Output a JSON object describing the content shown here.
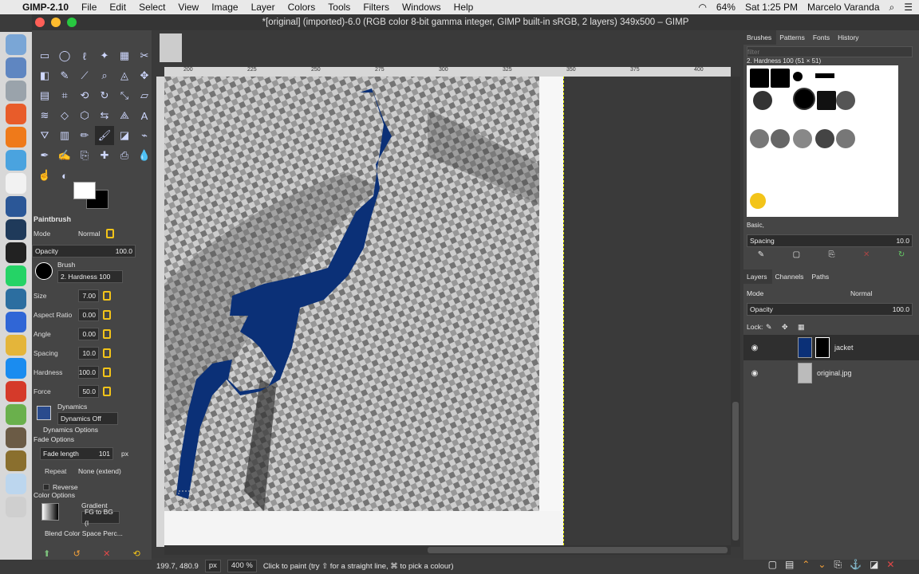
{
  "menubar": {
    "app_name": "GIMP-2.10",
    "menus": [
      "File",
      "Edit",
      "Select",
      "View",
      "Image",
      "Layer",
      "Colors",
      "Tools",
      "Filters",
      "Windows",
      "Help"
    ],
    "battery": "64%",
    "clock": "Sat 1:25 PM",
    "user": "Marcelo Varanda"
  },
  "window": {
    "title": "*[original] (imported)-6.0 (RGB color 8-bit gamma integer, GIMP built-in sRGB, 2 layers) 349x500 – GIMP"
  },
  "toolbox": {
    "tool_name": "Paintbrush",
    "mode_label": "Mode",
    "mode_value": "Normal",
    "opacity_label": "Opacity",
    "opacity_value": "100.0",
    "brush_label": "Brush",
    "brush_value": "2. Hardness 100",
    "size_label": "Size",
    "size_value": "7.00",
    "aspect_label": "Aspect Ratio",
    "aspect_value": "0.00",
    "angle_label": "Angle",
    "angle_value": "0.00",
    "spacing_label": "Spacing",
    "spacing_value": "10.0",
    "hardness_label": "Hardness",
    "hardness_value": "100.0",
    "force_label": "Force",
    "force_value": "50.0",
    "dynamics_label": "Dynamics",
    "dynamics_value": "Dynamics Off",
    "dynamics_options": "Dynamics Options",
    "fade_options": "Fade Options",
    "fade_length_label": "Fade length",
    "fade_length_value": "101",
    "fade_unit": "px",
    "repeat_label": "Repeat",
    "repeat_value": "None (extend)",
    "reverse_label": "Reverse",
    "color_options": "Color Options",
    "gradient_label": "Gradient",
    "gradient_value": "FG to BG (I",
    "blend_label": "Blend Color Space Perc..."
  },
  "ruler": {
    "ticks": [
      "200",
      "225",
      "250",
      "275",
      "300",
      "325",
      "350",
      "375",
      "400"
    ]
  },
  "statusbar": {
    "coords": "199.7, 480.9",
    "unit": "px",
    "zoom": "400 %",
    "hint": "Click to paint (try ⇧ for a straight line, ⌘ to pick a colour)"
  },
  "brushes_panel": {
    "tabs": [
      "Brushes",
      "Patterns",
      "Fonts",
      "History"
    ],
    "filter_placeholder": "filter",
    "selected_brush": "2. Hardness 100 (51 × 51)",
    "preset": "Basic,",
    "spacing_label": "Spacing",
    "spacing_value": "10.0"
  },
  "layers_panel": {
    "tabs": [
      "Layers",
      "Channels",
      "Paths"
    ],
    "mode_label": "Mode",
    "mode_value": "Normal",
    "opacity_label": "Opacity",
    "opacity_value": "100.0",
    "lock_label": "Lock:",
    "layers": [
      "jacket",
      "original.jpg"
    ]
  },
  "colors": {
    "paint": "#0b3077",
    "accent_yellow": "#f3c419"
  }
}
